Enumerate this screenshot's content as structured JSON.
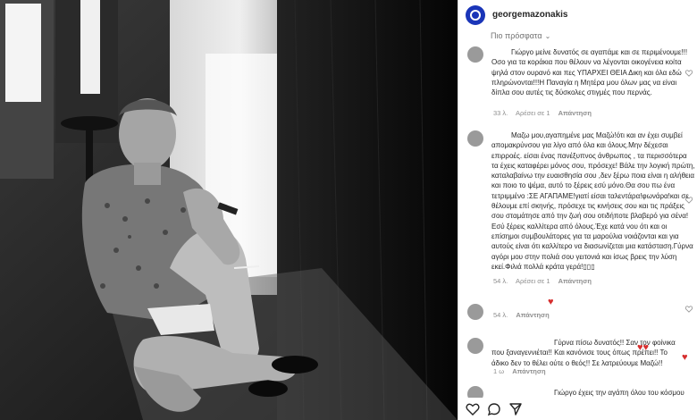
{
  "post": {
    "username": "georgemazonakis",
    "sort_label": "Πιο πρόσφατα"
  },
  "comments": [
    {
      "text": "Γιώργο μείνε δυνατός σε αγαπάμε και σε περιμένουμε!!!Οσο για τα κοράκια που θέλουν να λέγονται οικογένεια κοίτα ψηλά στον ουρανό και πες ΥΠΑΡΧΕΙ ΘΕΙΑ Δικη και όλα εδώ πληρώνονται!!!Η Παναγία η Μητέρα μου όλων μας να είναι δίπλα σου αυτές τις δύσκολες στιγμές που περνάς.",
      "time": "33 λ.",
      "likes": "Αρέσει σε 1",
      "reply": "Απάντηση"
    },
    {
      "text": "Μαζω μου,αγαπημένε μας Μαζώ!ότι και αν έχει συμβεί απομακρύνσου για λίγο από όλα και όλους.Μην δέχεσαι επιρροές. είσαι ένας πανέξυπνος άνθρωπος , τα περισσότερα τα έχεις καταφέρει μόνος σου, πρόσεχε! Βάλε την λογική πρώτη, καταλαβαίνω την ευαισθησία σου ,δεν ξέρω ποια είναι η αλήθεια και ποιο το ψέμα, αυτό το ξέρεις εσύ μόνο.Θα σου πω ένα τετριμμένο :ΣΕ ΑΓΑΠΑΜΕ!γιατί είσαι ταλεντάρα!φωνάρα!και σε θέλουμε επί σκηνής, πρόσεχε τις κινήσεις σου και τις πράξεις σου σταμάτησε από την ζωή σου οτιδήποτε βλαβερό για σένα! Εσύ ξέρεις καλλίτερα από όλους.Έχε κατά νου ότι και οι επίσημοι συμβουλάτορες για τα μαρούλια νοιάζονται και για αυτούς είναι ότι καλλίτερο να διασωνίζεται μια κατάσταση.Γύρνα αγόρι μου στην πολιά σου γειτονιά και ίσως βρεις την λύση εκεί.Φιλιά πολλά κράτα γερά!▯▯▯",
      "time": "54 λ.",
      "likes": "Αρέσει σε 1",
      "reply": "Απάντηση"
    },
    {
      "text": "",
      "time": "54 λ.",
      "likes": "",
      "reply": "Απάντηση"
    },
    {
      "text": "Γύρνα πίσω δυνατός!! Σαν τον φοίνικα που ξαναγεννιέται!! Και κανόνισε τους όπως πρέπει!! Το άδικο δεν το θέλει ούτε ο θεός!! Σε λατρεύουμε Μαζώ!!",
      "time": "1 ω",
      "likes": "",
      "reply": "Απάντηση"
    },
    {
      "text": "Γιώργο έχεις την αγάπη όλου του κόσμου",
      "time": "",
      "likes": "",
      "reply": ""
    }
  ],
  "icons": {
    "like": "heart-outline-icon",
    "comment": "comment-bubble-icon",
    "share": "paper-plane-icon"
  },
  "colors": {
    "avatar_blue": "#1a35b8",
    "heart_red": "#d62e2e",
    "muted_text": "#8e8e8e"
  }
}
